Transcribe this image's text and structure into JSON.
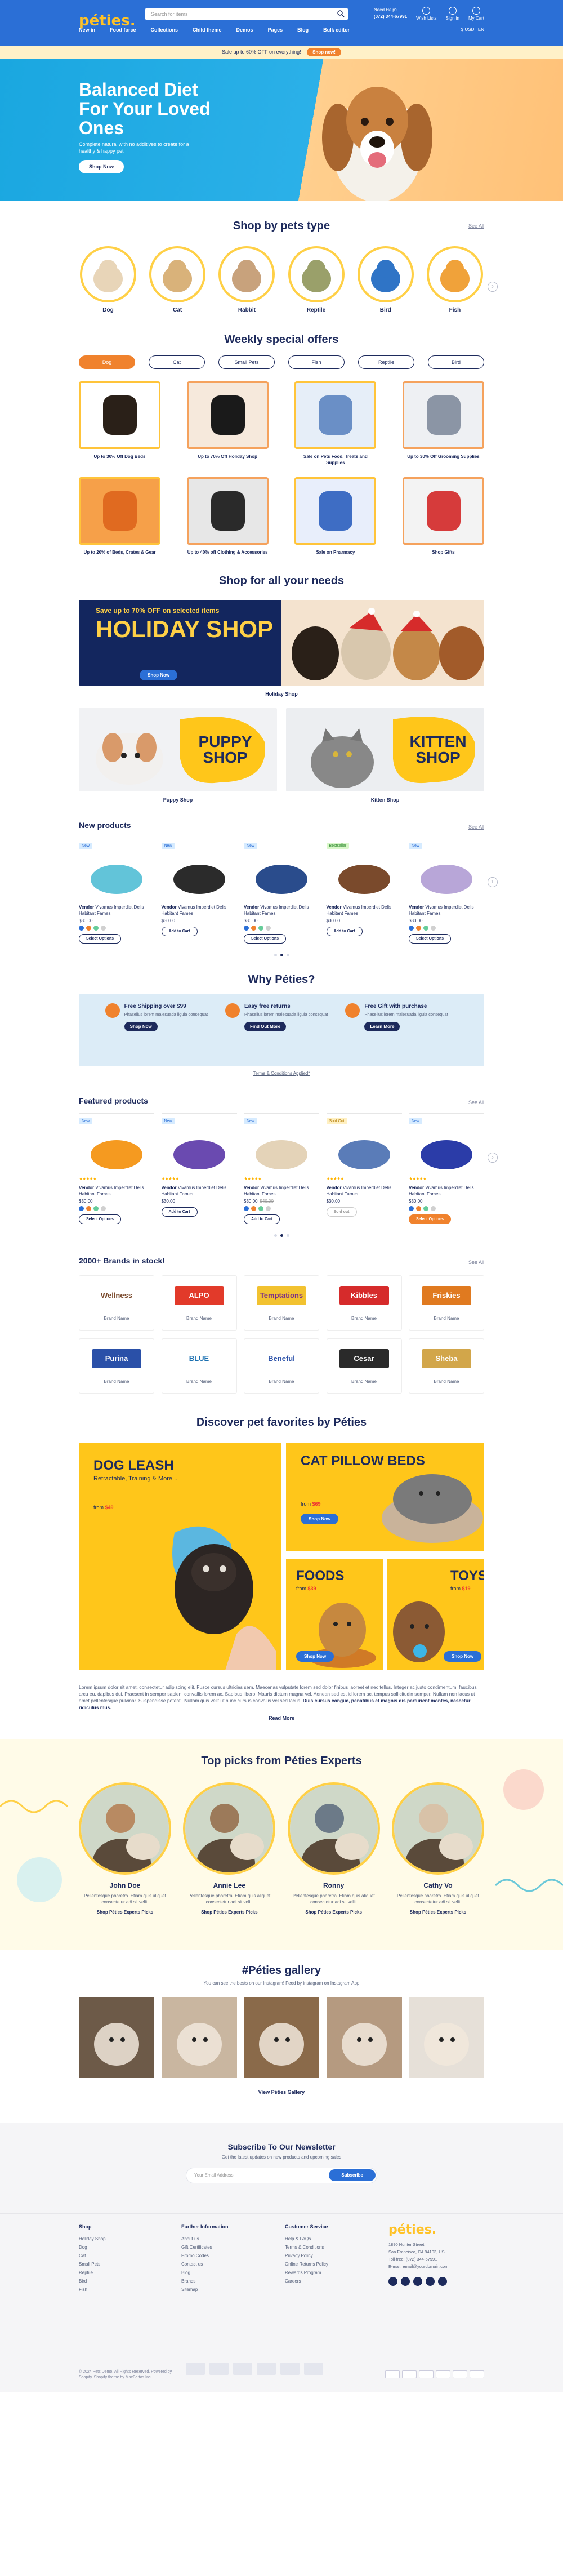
{
  "header": {
    "logo": "péties.",
    "search_placeholder": "Search for items",
    "phone_label": "Need Help?",
    "phone": "(072) 344-67991",
    "wish": "Wish Lists",
    "signin": "Sign in",
    "cart": "My Cart",
    "nav": [
      "New in",
      "Food force",
      "Collections",
      "Child theme",
      "Demos",
      "Pages",
      "Blog",
      "Bulk editor"
    ],
    "currency": "$ USD  |  EN"
  },
  "promo": {
    "text": "Sale up to 60% OFF on everything!",
    "button": "Shop now!"
  },
  "hero": {
    "title": "Balanced Diet For Your Loved Ones",
    "text": "Complete natural with no additives to create for a healthy & happy pet",
    "button": "Shop Now"
  },
  "pets_section": {
    "title": "Shop by pets type",
    "see_all": "See All",
    "items": [
      "Dog",
      "Cat",
      "Rabbit",
      "Reptile",
      "Bird",
      "Fish"
    ]
  },
  "offers_section": {
    "title": "Weekly special offers",
    "tabs": [
      "Dog",
      "Cat",
      "Small Pets",
      "Fish",
      "Reptile",
      "Bird"
    ],
    "items": [
      "Up to 30% Off Dog Beds",
      "Up to 70% Off Holiday Shop",
      "Sale on Pets Food, Treats and Supplies",
      "Up to 30% Off Grooming Supplies",
      "Up to 20% of Beds, Crates & Gear",
      "Up to 40% off Clothing & Accessories",
      "Sale on Pharmacy",
      "Shop Gifts"
    ]
  },
  "needs_section": {
    "title": "Shop for all your needs",
    "holiday_small": "Save up to 70% OFF on selected items",
    "holiday_big": "HOLIDAY SHOP",
    "holiday_button": "Shop Now",
    "holiday_caption": "Holiday Shop",
    "puppy_word": "PUPPY SHOP",
    "puppy_caption": "Puppy Shop",
    "kitten_word": "KITTEN SHOP",
    "kitten_caption": "Kitten Shop"
  },
  "new_products": {
    "title": "New products",
    "see_all": "See All",
    "items": [
      {
        "badge": "New",
        "vendor": "Vendor",
        "name": "Vivamus Imperdiet Delis Habitant Fames",
        "price": "$30.00",
        "old": "",
        "cta": "Select Options"
      },
      {
        "badge": "New",
        "vendor": "Vendor",
        "name": "Vivamus Imperdiet Delis Habitant Fames",
        "price": "$30.00",
        "old": "",
        "cta": "Add to Cart"
      },
      {
        "badge": "New",
        "vendor": "Vendor",
        "name": "Vivamus Imperdiet Delis Habitant Fames",
        "price": "$30.00",
        "old": "",
        "cta": "Select Options"
      },
      {
        "badge": "Bestseller",
        "vendor": "Vendor",
        "name": "Vivamus Imperdiet Delis Habitant Fames",
        "price": "$30.00",
        "old": "",
        "cta": "Add to Cart"
      },
      {
        "badge": "New",
        "vendor": "Vendor",
        "name": "Vivamus Imperdiet Delis Habitant Fames",
        "price": "$30.00",
        "old": "",
        "cta": "Select Options"
      }
    ]
  },
  "why": {
    "title": "Why Péties?",
    "items": [
      {
        "title": "Free Shipping over $99",
        "text": "Phasellus lorem malesuada ligula consequat",
        "link": "Shop Now"
      },
      {
        "title": "Easy free returns",
        "text": "Phasellus lorem malesuada ligula consequat",
        "link": "Find Out More"
      },
      {
        "title": "Free Gift with purchase",
        "text": "Phasellus lorem malesuada ligula consequat",
        "link": "Learn More"
      }
    ],
    "terms": "Terms & Conditions Applied*"
  },
  "featured": {
    "title": "Featured products",
    "see_all": "See All",
    "items": [
      {
        "badge": "New",
        "vendor": "Vendor",
        "name": "Vivamus Imperdiet Delis Habitant Fames",
        "price": "$30.00",
        "old": "",
        "cta": "Select Options"
      },
      {
        "badge": "New",
        "vendor": "Vendor",
        "name": "Vivamus Imperdiet Delis Habitant Fames",
        "price": "$30.00",
        "old": "",
        "cta": "Add to Cart"
      },
      {
        "badge": "New",
        "vendor": "Vendor",
        "name": "Vivamus Imperdiet Delis Habitant Fames",
        "price": "$30.00",
        "old": "$40.00",
        "cta": "Add to Cart"
      },
      {
        "badge": "Sold Out",
        "vendor": "Vendor",
        "name": "Vivamus Imperdiet Delis Habitant Fames",
        "price": "$30.00",
        "old": "",
        "cta": "Sold out"
      },
      {
        "badge": "New",
        "vendor": "Vendor",
        "name": "Vivamus Imperdiet Delis Habitant Fames",
        "price": "$30.00",
        "old": "",
        "cta": "Select Options"
      }
    ]
  },
  "brands": {
    "title": "2000+ Brands in stock!",
    "see_all": "See All",
    "caption": "Brand Name",
    "logos": [
      "Wellness",
      "ALPO",
      "Temptations",
      "Kibbles",
      "Friskies",
      "Purina",
      "BLUE",
      "Beneful",
      "Cesar",
      "Sheba"
    ]
  },
  "discover": {
    "title": "Discover pet favorites by Péties",
    "leash_title": "DOG LEASH",
    "leash_sub": "Retractable, Training & More...",
    "leash_price": "$49",
    "beds_title": "CAT PILLOW BEDS",
    "beds_price": "$69",
    "foods_title": "FOODS",
    "foods_price": "$39",
    "toys_title": "TOYS",
    "toys_price": "$19",
    "from": "from",
    "button": "Shop Now"
  },
  "paragraph": {
    "text": "Lorem ipsum dolor sit amet, consectetur adipiscing elit. Fusce cursus ultricies sem. Maecenas vulputate lorem sed dolor finibus laoreet et nec tellus. Integer ac justo condimentum, faucibus arcu eu, dapibus dui. Praesent in semper sapien, convallis lorem ac. Sapibus libero. Mauris dictum magna vel. Aenean sed est id lorem ac, tempus sollicitudin semper. Nullam non lacus ut amet pellentesque pulvinar. Suspendisse potenti. Nullam quis velit ut nunc cursus convallis vel sed lacus. ",
    "bold": "Duis cursus congue, penatibus et magnis dis parturient montes, nascetur ridiculus mus.",
    "readmore": "Read More"
  },
  "experts": {
    "title": "Top picks from Péties Experts",
    "items": [
      {
        "name": "John Doe",
        "text": "Pellentesque pharetra. Etiam quis aliquet consectetur adi sit velit.",
        "link": "Shop Péties Experts Picks"
      },
      {
        "name": "Annie Lee",
        "text": "Pellentesque pharetra. Etiam quis aliquet consectetur adi sit velit.",
        "link": "Shop Péties Experts Picks"
      },
      {
        "name": "Ronny",
        "text": "Pellentesque pharetra. Etiam quis aliquet consectetur adi sit velit.",
        "link": "Shop Péties Experts Picks"
      },
      {
        "name": "Cathy Vo",
        "text": "Pellentesque pharetra. Etiam quis aliquet consectetur adi sit velit.",
        "link": "Shop Péties Experts Picks"
      }
    ]
  },
  "gallery": {
    "title": "#Péties gallery",
    "sub": "You can see the bests on our Instagram! Feed by instagram on Instagram App",
    "link": "View Péties Gallery"
  },
  "newsletter": {
    "title": "Subscribe To Our Newsletter",
    "sub": "Get the latest updates on new products and upcoming sales",
    "placeholder": "Your Email Address",
    "button": "Subscribe"
  },
  "footer": {
    "shop_title": "Shop",
    "shop": [
      "Holiday Shop",
      "Dog",
      "Cat",
      "Small Pets",
      "Reptile",
      "Bird",
      "Fish"
    ],
    "info_title": "Further Information",
    "info": [
      "About us",
      "Gift Certificates",
      "Promo Codes",
      "Contact us",
      "Blog",
      "Brands",
      "Sitemap"
    ],
    "cs_title": "Customer Service",
    "cs": [
      "Help & FAQs",
      "Terms & Conditions",
      "Privacy Policy",
      "Online Returns Policy",
      "Rewards Program",
      "Careers"
    ],
    "logo": "péties.",
    "address": [
      "1890 Hunter Street,",
      "San Francisco, CA 94103, US",
      "Toll-free: (072) 344-67991",
      "E-mail: email@yourdomain.com"
    ],
    "copy": "© 2024 Pets Demo. All Rights Reserved. Powered by Shopify. Shopify theme by MaxBertos Inc."
  },
  "colors": {
    "blue": "#2b6fd6",
    "navy": "#1d2a5c",
    "orange": "#f0822d",
    "yellow": "#ffc61a"
  }
}
